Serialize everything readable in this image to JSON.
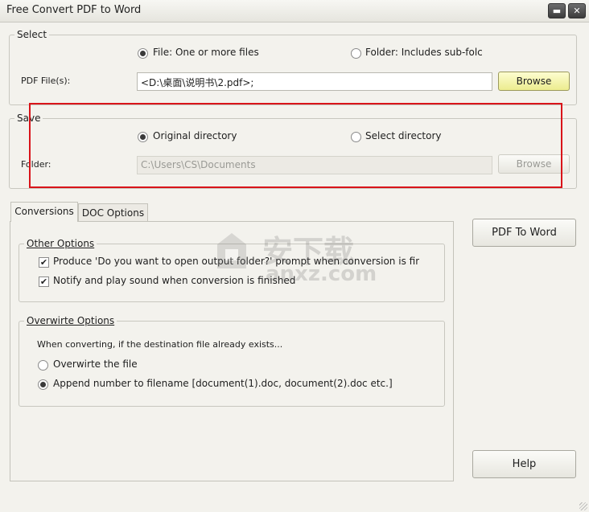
{
  "window": {
    "title": "Free Convert PDF to Word",
    "minimize_glyph": "▬",
    "close_glyph": "✕"
  },
  "select": {
    "group_label": "Select",
    "radio_file_label": "File:  One or more files",
    "radio_folder_label": "Folder: Includes sub-folc",
    "pdf_files_label": "PDF File(s):",
    "pdf_files_value": "<D:\\桌面\\说明书\\2.pdf>;",
    "browse_label": "Browse"
  },
  "save": {
    "group_label": "Save",
    "radio_original_label": "Original directory",
    "radio_select_label": "Select directory",
    "folder_label": "Folder:",
    "folder_value": "C:\\Users\\CS\\Documents",
    "browse_label": "Browse"
  },
  "tabs": [
    {
      "label": "Conversions"
    },
    {
      "label": "DOC Options"
    }
  ],
  "other_options": {
    "group_label": "Other Options",
    "checkbox1_label": "Produce 'Do you want to open output folder?' prompt when conversion is finis",
    "checkbox2_label": "Notify and play sound when conversion is finished"
  },
  "overwrite_options": {
    "group_label": "Overwirte Options",
    "description": "When converting, if the destination file already exists...",
    "radio1_label": "Overwirte the file",
    "radio2_label": "Append number to filename  [document(1).doc, document(2).doc etc.]"
  },
  "actions": {
    "pdf_to_word_label": "PDF To Word",
    "help_label": "Help"
  },
  "watermark": {
    "cn": "安下载",
    "en": "anxz.com"
  },
  "colors": {
    "annotation_red": "#d9141a",
    "browse_yellow": "#ecec8f"
  }
}
